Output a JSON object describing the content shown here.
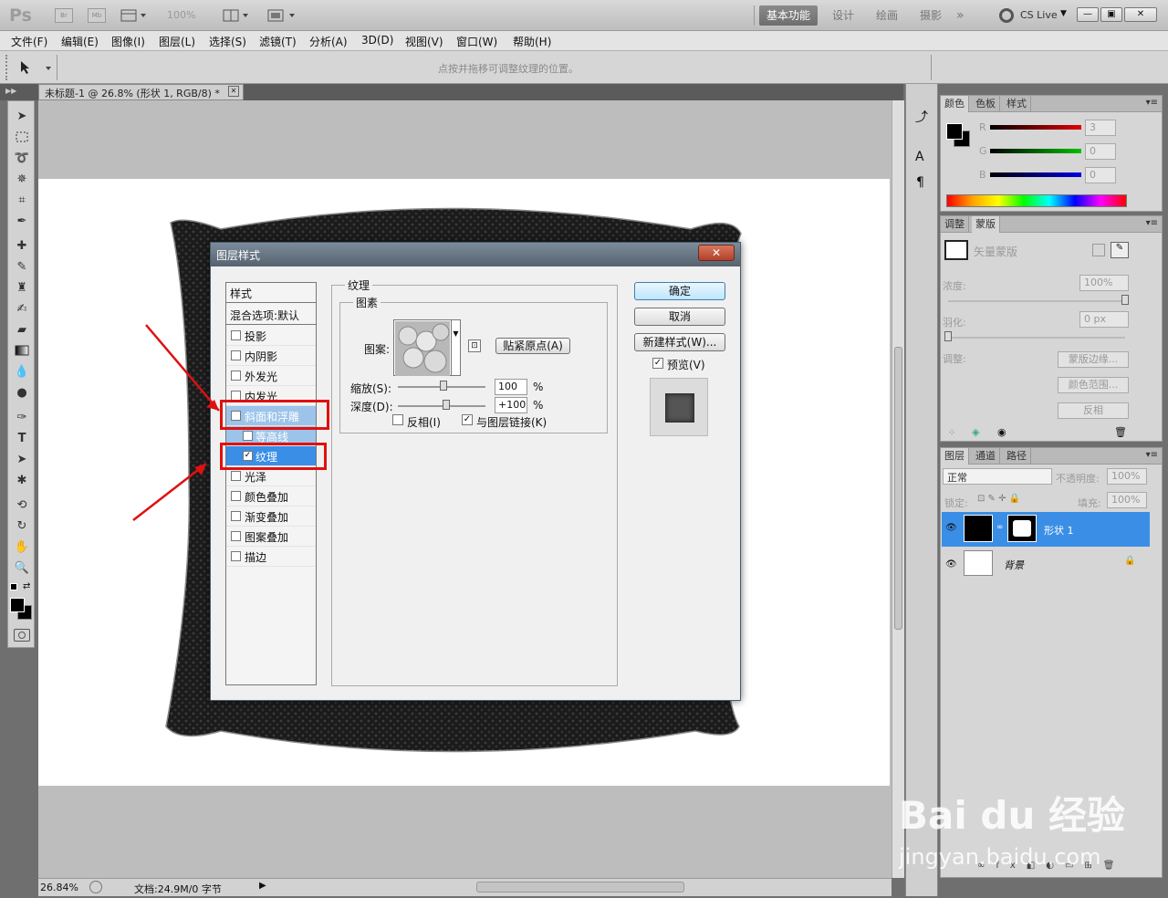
{
  "app": {
    "logo": "Ps",
    "bridge_label": "Br",
    "minibridge_label": "Mb",
    "zoom_select": "100%",
    "workspaces": [
      "基本功能",
      "设计",
      "绘画",
      "摄影"
    ],
    "more_label": "»",
    "cs_live": "CS Live",
    "window_buttons": [
      "—",
      "▣",
      "✕"
    ]
  },
  "menu": [
    "文件(F)",
    "编辑(E)",
    "图像(I)",
    "图层(L)",
    "选择(S)",
    "滤镜(T)",
    "分析(A)",
    "3D(D)",
    "视图(V)",
    "窗口(W)",
    "帮助(H)"
  ],
  "options_bar": {
    "hint": "点按并拖移可调整纹理的位置。"
  },
  "document": {
    "tab_title": "未标题-1 @ 26.8% (形状 1, RGB/8) *",
    "close": "✕"
  },
  "status": {
    "zoom": "26.84%",
    "doc_info": "文档:24.9M/0 字节"
  },
  "dialog": {
    "title": "图层样式",
    "close": "✕",
    "styles_header": "样式",
    "blend_options": "混合选项:默认",
    "items": [
      {
        "label": "投影",
        "checked": false
      },
      {
        "label": "内阴影",
        "checked": false
      },
      {
        "label": "外发光",
        "checked": false
      },
      {
        "label": "内发光",
        "checked": false
      },
      {
        "label": "斜面和浮雕",
        "checked": true
      },
      {
        "label": "等高线",
        "checked": false
      },
      {
        "label": "纹理",
        "checked": true
      },
      {
        "label": "光泽",
        "checked": false
      },
      {
        "label": "颜色叠加",
        "checked": false
      },
      {
        "label": "渐变叠加",
        "checked": false
      },
      {
        "label": "图案叠加",
        "checked": false
      },
      {
        "label": "描边",
        "checked": false
      }
    ],
    "section_title": "纹理",
    "group_title": "图素",
    "pattern_label": "图案:",
    "snap_button": "贴紧原点(A)",
    "scale_label": "缩放(S):",
    "scale_value": "100",
    "scale_level": 100,
    "depth_label": "深度(D):",
    "depth_value": "+100",
    "depth_level": 100,
    "percent": "%",
    "invert_label": "反相(I)",
    "invert_checked": false,
    "link_label": "与图层链接(K)",
    "link_checked": true,
    "ok_button": "确定",
    "cancel_button": "取消",
    "new_style_button": "新建样式(W)...",
    "preview_label": "预览(V)",
    "preview_checked": true
  },
  "color_panel": {
    "tabs": [
      "颜色",
      "色板",
      "样式"
    ],
    "channels": [
      {
        "label": "R",
        "value": "3",
        "color": "#cc0000"
      },
      {
        "label": "G",
        "value": "0",
        "color": "#00aa00"
      },
      {
        "label": "B",
        "value": "0",
        "color": "#0000cc"
      }
    ]
  },
  "masks_panel": {
    "tabs": [
      "调整",
      "蒙版"
    ],
    "mask_type": "矢量蒙版",
    "density_label": "浓度:",
    "density_value": "100%",
    "feather_label": "羽化:",
    "feather_value": "0 px",
    "adjust_label": "调整:",
    "buttons": [
      "蒙版边缘...",
      "颜色范围...",
      "反相"
    ]
  },
  "layers_panel": {
    "tabs": [
      "图层",
      "通道",
      "路径"
    ],
    "blend_mode": "正常",
    "opacity_label": "不透明度:",
    "opacity_value": "100%",
    "lock_label": "锁定:",
    "fill_label": "填充:",
    "fill_value": "100%",
    "layers": [
      {
        "name": "形状 1",
        "selected": true
      },
      {
        "name": "背景",
        "selected": false
      }
    ]
  },
  "watermark": {
    "brand": "Bai du 经验",
    "url": "jingyan.baidu.com"
  },
  "colors": {
    "selection_blue": "#3a8ee6",
    "light_blue": "#9cc4ea",
    "annotation_red": "#e01010"
  }
}
